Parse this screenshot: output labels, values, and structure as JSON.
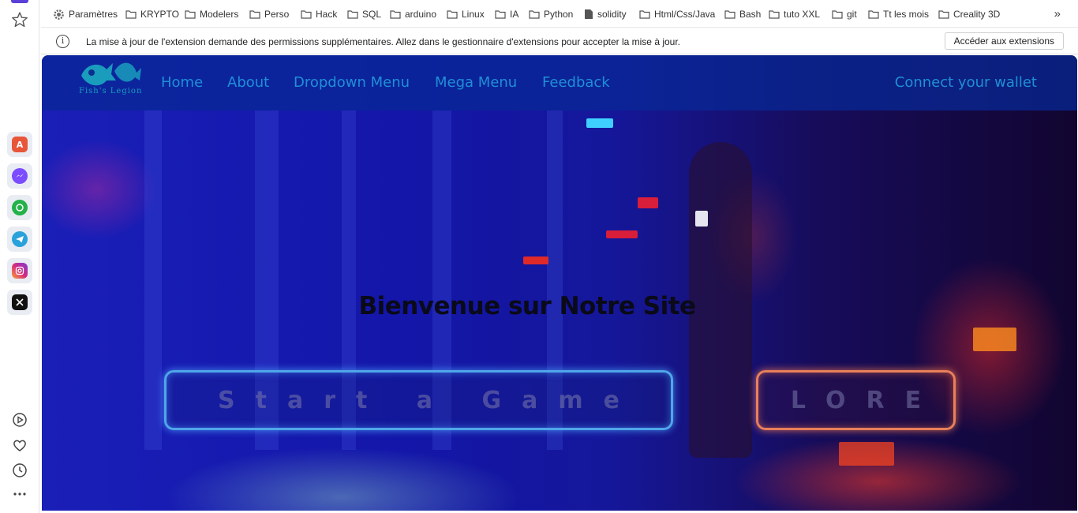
{
  "bookmarks": [
    {
      "label": "Paramètres",
      "icon": "gear-icon"
    },
    {
      "label": "KRYPTO",
      "icon": "folder-icon"
    },
    {
      "label": "Modelers",
      "icon": "folder-icon"
    },
    {
      "label": "Perso",
      "icon": "folder-icon"
    },
    {
      "label": "Hack",
      "icon": "folder-icon"
    },
    {
      "label": "SQL",
      "icon": "folder-icon"
    },
    {
      "label": "arduino",
      "icon": "folder-icon"
    },
    {
      "label": "Linux",
      "icon": "folder-icon"
    },
    {
      "label": "IA",
      "icon": "folder-icon"
    },
    {
      "label": "Python",
      "icon": "folder-icon"
    },
    {
      "label": "solidity",
      "icon": "file-icon"
    },
    {
      "label": "Html/Css/Java",
      "icon": "folder-icon"
    },
    {
      "label": "Bash",
      "icon": "folder-icon"
    },
    {
      "label": "tuto XXL",
      "icon": "folder-icon"
    },
    {
      "label": "git",
      "icon": "folder-icon"
    },
    {
      "label": "Tt les mois",
      "icon": "folder-icon"
    },
    {
      "label": "Creality 3D",
      "icon": "folder-icon"
    }
  ],
  "bookmarks_more": "»",
  "infobar": {
    "message": "La mise à jour de l'extension demande des permissions supplémentaires. Allez dans le gestionnaire d'extensions pour accepter la mise à jour.",
    "button_label": "Accéder aux extensions"
  },
  "sidebar": {
    "apps": [
      {
        "name": "aria-icon",
        "color": "#e8563a"
      },
      {
        "name": "messenger-icon",
        "color": "#7b4dff"
      },
      {
        "name": "whatsapp-icon",
        "color": "#25b14a"
      },
      {
        "name": "telegram-icon",
        "color": "#2aa1da"
      },
      {
        "name": "instagram-icon",
        "color": "#d62a7c"
      },
      {
        "name": "x-icon",
        "color": "#111111"
      }
    ]
  },
  "site": {
    "logo_text": "Fish's Legion",
    "nav": [
      "Home",
      "About",
      "Dropdown Menu",
      "Mega Menu",
      "Feedback"
    ],
    "wallet_label": "Connect your wallet",
    "hero_title": "Bienvenue sur Notre Site",
    "start_button": "Start a Game",
    "lore_button": "LORE"
  },
  "colors": {
    "nav_link": "#1f8fd6",
    "start_border": "#4fa6ea",
    "lore_border": "#e8805a"
  }
}
